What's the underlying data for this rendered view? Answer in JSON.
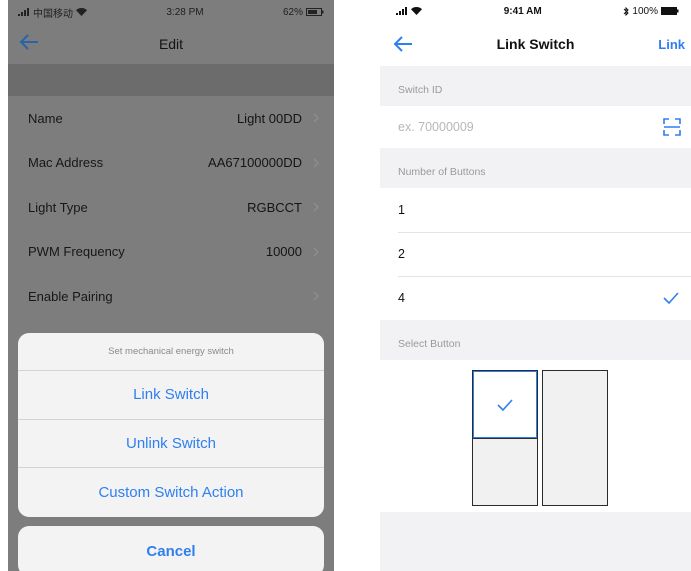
{
  "left_phone": {
    "status": {
      "carrier": "中国移动",
      "time": "3:28 PM",
      "battery": "62%"
    },
    "nav": {
      "title": "Edit",
      "back_icon": "back-arrow-icon"
    },
    "rows": [
      {
        "label": "Name",
        "value": "Light 00DD"
      },
      {
        "label": "Mac Address",
        "value": "AA67100000DD"
      },
      {
        "label": "Light Type",
        "value": "RGBCCT"
      },
      {
        "label": "PWM Frequency",
        "value": "10000"
      },
      {
        "label": "Enable Pairing",
        "value": ""
      }
    ],
    "action_sheet": {
      "title": "Set mechanical energy switch",
      "options": [
        "Link Switch",
        "Unlink Switch",
        "Custom Switch Action"
      ],
      "cancel": "Cancel"
    }
  },
  "right_phone": {
    "status": {
      "time": "9:41 AM",
      "battery": "100%"
    },
    "nav": {
      "title": "Link Switch",
      "action": "Link"
    },
    "switch_id": {
      "header": "Switch ID",
      "placeholder": "ex. 70000009",
      "value": ""
    },
    "buttons_count": {
      "header": "Number of Buttons",
      "options": [
        "1",
        "2",
        "4"
      ],
      "selected": "4"
    },
    "select_button": {
      "header": "Select Button",
      "selected": "top-left"
    }
  },
  "colors": {
    "accent": "#2f7ff0",
    "dim_overlay": "#7d7d7d",
    "background": "#f2f2f4"
  }
}
